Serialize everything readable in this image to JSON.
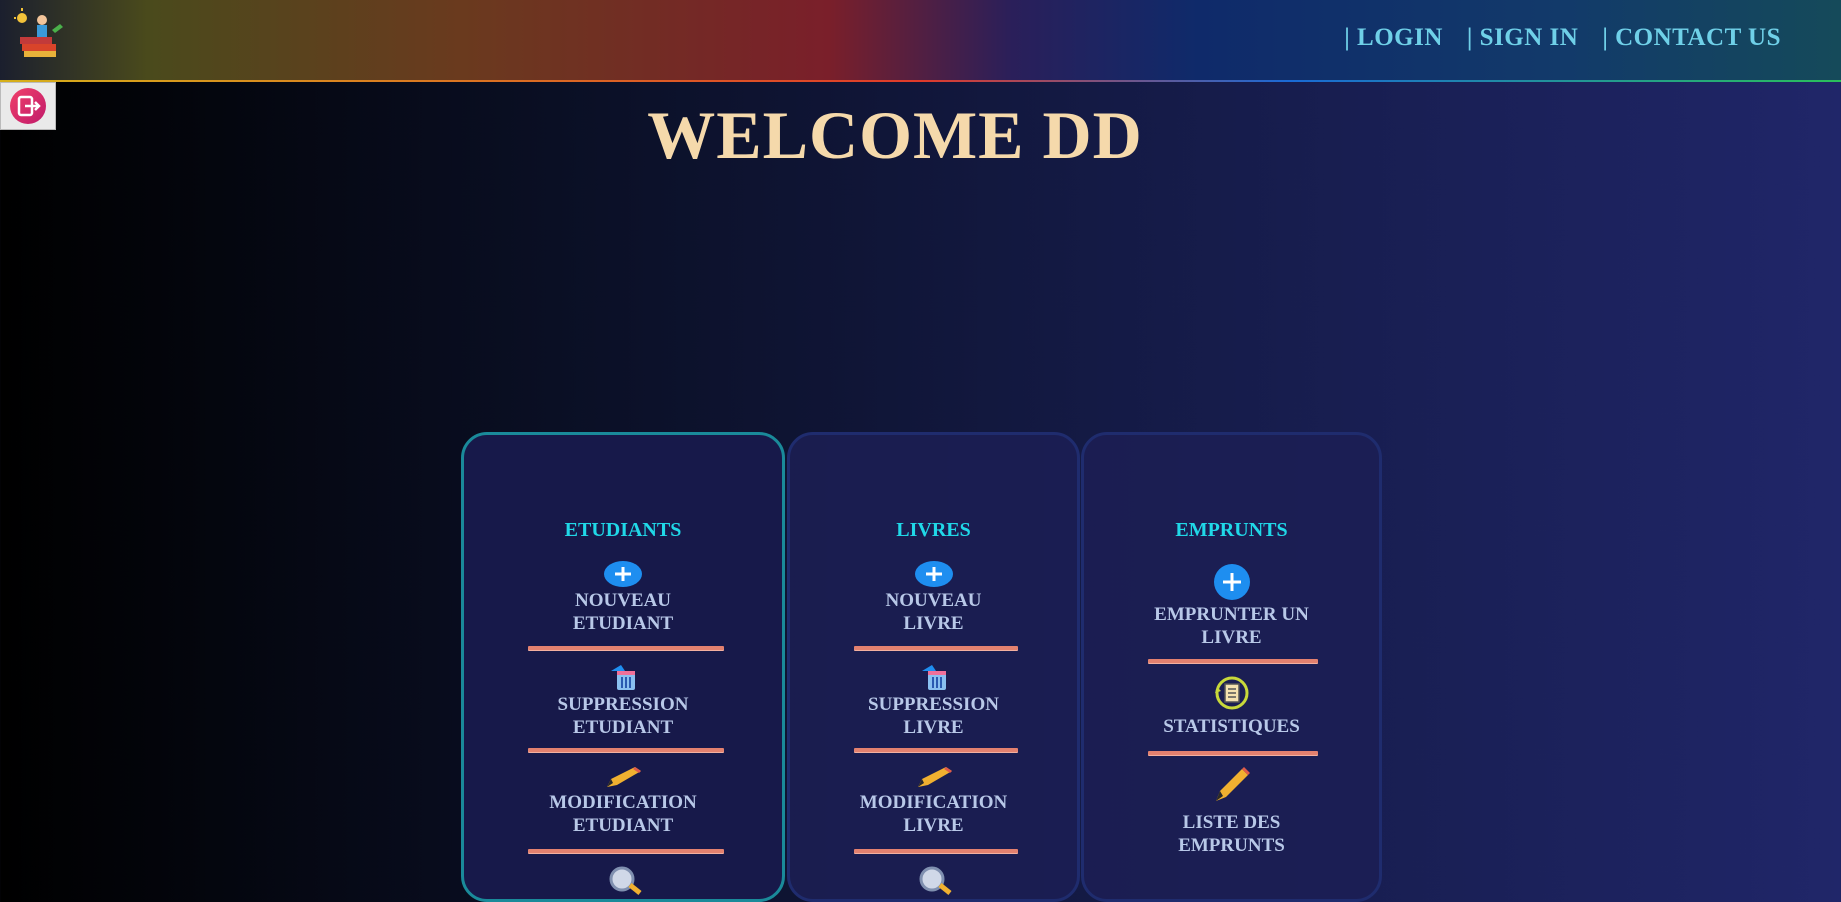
{
  "header": {
    "nav": [
      "| LOGIN",
      "| SIGN IN",
      "| CONTACT US"
    ]
  },
  "welcome": "WELCOME DD",
  "cards": [
    {
      "title": "ETUDIANTS",
      "items": [
        {
          "label": "NOUVEAU ETUDIANT",
          "icon": "plus-circle-icon"
        },
        {
          "label": "SUPPRESSION ETUDIANT",
          "icon": "trash-icon"
        },
        {
          "label": "MODIFICATION ETUDIANT",
          "icon": "pencil-icon"
        }
      ]
    },
    {
      "title": "LIVRES",
      "items": [
        {
          "label": "NOUVEAU LIVRE",
          "icon": "plus-circle-icon"
        },
        {
          "label": "SUPPRESSION LIVRE",
          "icon": "trash-icon"
        },
        {
          "label": "MODIFICATION LIVRE",
          "icon": "pencil-icon"
        }
      ]
    },
    {
      "title": "EMPRUNTS",
      "items": [
        {
          "label": "EMPRUNTER UN LIVRE",
          "icon": "plus-circle-icon"
        },
        {
          "label": "STATISTIQUES",
          "icon": "statistics-icon"
        },
        {
          "label": "LISTE DES EMPRUNTS",
          "icon": "pencil-icon"
        }
      ]
    }
  ]
}
